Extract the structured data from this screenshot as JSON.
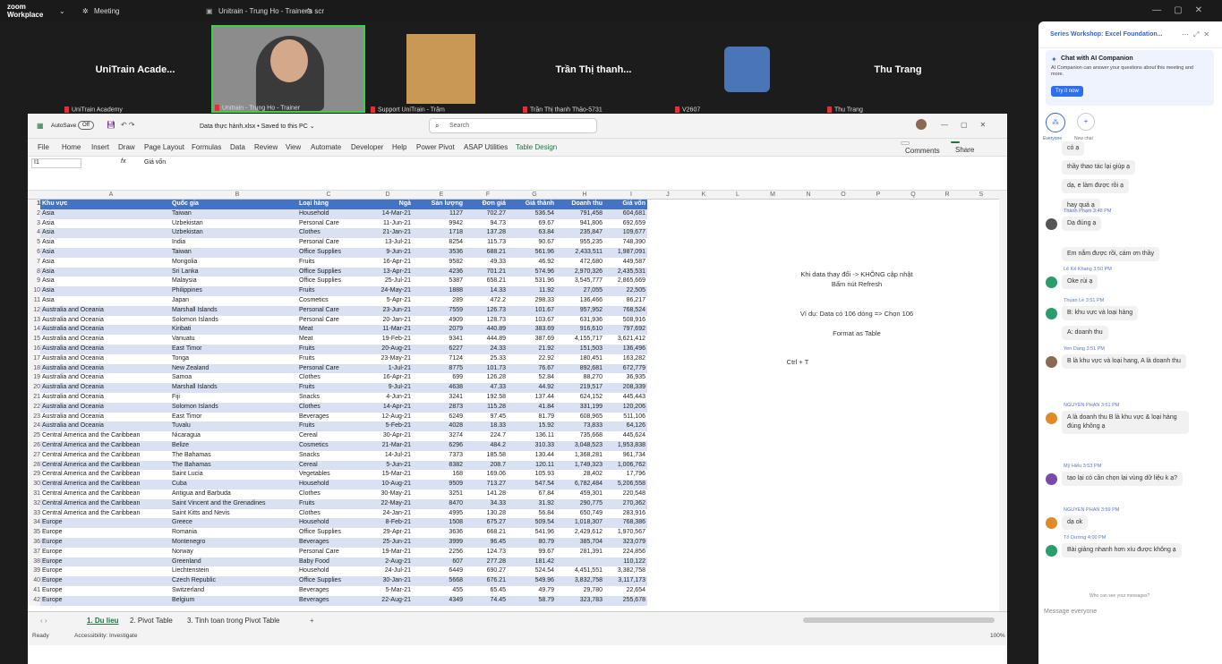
{
  "zoom": {
    "logo": "zoom",
    "logo_sub": "Workplace",
    "meeting": "Meeting",
    "share_title": "Unitrain - Trung Ho - Trainer's scr"
  },
  "videos": [
    {
      "name": "UniTrain Acade...",
      "label": "UniTrain Academy"
    },
    {
      "name": "",
      "label": "Unitrain - Trung Ho - Trainer"
    },
    {
      "name": "",
      "label": "Support UniTrain - Trâm"
    },
    {
      "name": "Trần Thị thanh...",
      "label": "Trần Thị thanh Thảo-5731"
    },
    {
      "name": "",
      "label": "V2607"
    },
    {
      "name": "Thu Trang",
      "label": "Thu Trang"
    }
  ],
  "excel": {
    "autosave": "AutoSave",
    "autosave_state": "Off",
    "file": "Data thực hành.xlsx • Saved to this PC ⌄",
    "search": "Search",
    "menu": [
      "File",
      "Home",
      "Insert",
      "Draw",
      "Page Layout",
      "Formulas",
      "Data",
      "Review",
      "View",
      "Automate",
      "Developer",
      "Help",
      "Power Pivot",
      "ASAP Utilities",
      "Table Design"
    ],
    "comments": "Comments",
    "share": "Share",
    "namebox": "I1",
    "formula": "Giá vốn",
    "fx": "fx",
    "cols": [
      "A",
      "B",
      "C",
      "D",
      "E",
      "F",
      "G",
      "H",
      "I",
      "J",
      "K",
      "L",
      "M",
      "N",
      "O",
      "P",
      "Q",
      "R",
      "S"
    ],
    "headers": [
      "Khu vực",
      "Quốc gia",
      "Loại hàng",
      "Ngà",
      "Sản lượng",
      "Đơn giá",
      "Giá thành",
      "Doanh thu",
      "Giá vốn"
    ],
    "rows": [
      [
        "Asia",
        "Taiwan",
        "Household",
        "14-Mar-21",
        "1127",
        "702.27",
        "536.54",
        "791,458",
        "604,681"
      ],
      [
        "Asia",
        "Uzbekistan",
        "Personal Care",
        "11-Jun-21",
        "9942",
        "94.73",
        "69.67",
        "941,806",
        "692,659"
      ],
      [
        "Asia",
        "Uzbekistan",
        "Clothes",
        "21-Jan-21",
        "1718",
        "137.28",
        "63.84",
        "235,847",
        "109,677"
      ],
      [
        "Asia",
        "India",
        "Personal Care",
        "13-Jul-21",
        "8254",
        "115.73",
        "90.67",
        "955,235",
        "748,390"
      ],
      [
        "Asia",
        "Taiwan",
        "Office Supplies",
        "9-Jun-21",
        "3536",
        "688.21",
        "561.96",
        "2,433,511",
        "1,987,091"
      ],
      [
        "Asia",
        "Mongolia",
        "Fruits",
        "16-Apr-21",
        "9582",
        "49.33",
        "46.92",
        "472,680",
        "449,587"
      ],
      [
        "Asia",
        "Sri Lanka",
        "Office Supplies",
        "13-Apr-21",
        "4236",
        "701.21",
        "574.96",
        "2,970,326",
        "2,435,531"
      ],
      [
        "Asia",
        "Malaysia",
        "Office Supplies",
        "25-Jul-21",
        "5387",
        "658.21",
        "531.96",
        "3,545,777",
        "2,865,669"
      ],
      [
        "Asia",
        "Philippines",
        "Fruits",
        "24-May-21",
        "1888",
        "14.33",
        "11.92",
        "27,055",
        "22,505"
      ],
      [
        "Asia",
        "Japan",
        "Cosmetics",
        "5-Apr-21",
        "289",
        "472.2",
        "298.33",
        "136,466",
        "86,217"
      ],
      [
        "Australia and Oceania",
        "Marshall Islands",
        "Personal Care",
        "23-Jun-21",
        "7559",
        "126.73",
        "101.67",
        "957,952",
        "768,524"
      ],
      [
        "Australia and Oceania",
        "Solomon Islands",
        "Personal Care",
        "20-Jan-21",
        "4909",
        "128.73",
        "103.67",
        "631,936",
        "508,916"
      ],
      [
        "Australia and Oceania",
        "Kiribati",
        "Meat",
        "11-Mar-21",
        "2079",
        "440.89",
        "383.69",
        "916,610",
        "797,692"
      ],
      [
        "Australia and Oceania",
        "Vanuatu",
        "Meat",
        "19-Feb-21",
        "9341",
        "444.89",
        "387.69",
        "4,155,717",
        "3,621,412"
      ],
      [
        "Australia and Oceania",
        "East Timor",
        "Fruits",
        "20-Aug-21",
        "6227",
        "24.33",
        "21.92",
        "151,503",
        "136,496"
      ],
      [
        "Australia and Oceania",
        "Tonga",
        "Fruits",
        "23-May-21",
        "7124",
        "25.33",
        "22.92",
        "180,451",
        "163,282"
      ],
      [
        "Australia and Oceania",
        "New Zealand",
        "Personal Care",
        "1-Jul-21",
        "8775",
        "101.73",
        "76.67",
        "892,681",
        "672,779"
      ],
      [
        "Australia and Oceania",
        "Samoa",
        "Clothes",
        "16-Apr-21",
        "699",
        "126.28",
        "52.84",
        "88,270",
        "36,935"
      ],
      [
        "Australia and Oceania",
        "Marshall Islands",
        "Fruits",
        "9-Jul-21",
        "4638",
        "47.33",
        "44.92",
        "219,517",
        "208,339"
      ],
      [
        "Australia and Oceania",
        "Fiji",
        "Snacks",
        "4-Jun-21",
        "3241",
        "192.58",
        "137.44",
        "624,152",
        "445,443"
      ],
      [
        "Australia and Oceania",
        "Solomon Islands",
        "Clothes",
        "14-Apr-21",
        "2873",
        "115.28",
        "41.84",
        "331,199",
        "120,206"
      ],
      [
        "Australia and Oceania",
        "East Timor",
        "Beverages",
        "12-Aug-21",
        "6249",
        "97.45",
        "81.79",
        "608,965",
        "511,106"
      ],
      [
        "Australia and Oceania",
        "Tuvalu",
        "Fruits",
        "5-Feb-21",
        "4028",
        "18.33",
        "15.92",
        "73,833",
        "64,126"
      ],
      [
        "Central America and the Caribbean",
        "Nicaragua",
        "Cereal",
        "30-Apr-21",
        "3274",
        "224.7",
        "136.11",
        "735,668",
        "445,624"
      ],
      [
        "Central America and the Caribbean",
        "Belize",
        "Cosmetics",
        "21-Mar-21",
        "6296",
        "484.2",
        "310.33",
        "3,048,523",
        "1,953,838"
      ],
      [
        "Central America and the Caribbean",
        "The Bahamas",
        "Snacks",
        "14-Jul-21",
        "7373",
        "185.58",
        "130.44",
        "1,368,281",
        "961,734"
      ],
      [
        "Central America and the Caribbean",
        "The Bahamas",
        "Cereal",
        "5-Jun-21",
        "8382",
        "208.7",
        "120.11",
        "1,749,323",
        "1,006,762"
      ],
      [
        "Central America and the Caribbean",
        "Saint Lucia",
        "Vegetables",
        "15-Mar-21",
        "168",
        "169.06",
        "105.93",
        "28,402",
        "17,796"
      ],
      [
        "Central America and the Caribbean",
        "Cuba",
        "Household",
        "10-Aug-21",
        "9509",
        "713.27",
        "547.54",
        "6,782,484",
        "5,206,558"
      ],
      [
        "Central America and the Caribbean",
        "Antigua and Barbuda",
        "Clothes",
        "30-May-21",
        "3251",
        "141.28",
        "67.84",
        "459,301",
        "220,548"
      ],
      [
        "Central America and the Caribbean",
        "Saint Vincent and the Grenadines",
        "Fruits",
        "22-May-21",
        "8470",
        "34.33",
        "31.92",
        "290,775",
        "270,362"
      ],
      [
        "Central America and the Caribbean",
        "Saint Kitts and Nevis",
        "Clothes",
        "24-Jan-21",
        "4995",
        "130.28",
        "56.84",
        "650,749",
        "283,916"
      ],
      [
        "Europe",
        "Greece",
        "Household",
        "8-Feb-21",
        "1508",
        "675.27",
        "509.54",
        "1,018,307",
        "768,386"
      ],
      [
        "Europe",
        "Romania",
        "Office Supplies",
        "29-Apr-21",
        "3636",
        "668.21",
        "541.96",
        "2,429,612",
        "1,970,567"
      ],
      [
        "Europe",
        "Montenegro",
        "Beverages",
        "25-Jun-21",
        "3999",
        "96.45",
        "80.79",
        "385,704",
        "323,079"
      ],
      [
        "Europe",
        "Norway",
        "Personal Care",
        "19-Mar-21",
        "2256",
        "124.73",
        "99.67",
        "281,391",
        "224,856"
      ],
      [
        "Europe",
        "Greenland",
        "Baby Food",
        "2-Aug-21",
        "607",
        "277.28",
        "181.42",
        "",
        "110,122"
      ],
      [
        "Europe",
        "Liechtenstein",
        "Household",
        "24-Jul-21",
        "6449",
        "690.27",
        "524.54",
        "4,451,551",
        "3,382,758"
      ],
      [
        "Europe",
        "Czech Republic",
        "Office Supplies",
        "30-Jan-21",
        "5668",
        "676.21",
        "549.96",
        "3,832,758",
        "3,117,173"
      ],
      [
        "Europe",
        "Switzerland",
        "Beverages",
        "5-Mar-21",
        "455",
        "65.45",
        "49.79",
        "29,780",
        "22,654"
      ],
      [
        "Europe",
        "Belgium",
        "Beverages",
        "22-Aug-21",
        "4349",
        "74.45",
        "58.79",
        "323,783",
        "255,678"
      ]
    ],
    "notes": [
      "Khi data thay đổi -> KHÔNG cập nhật",
      "Bấm nút Refresh",
      "Ví dụ: Data có 106 dòng => Chọn 106",
      "Format as Table",
      "Ctrl + T"
    ],
    "tabs": [
      "1. Du lieu",
      "2. Pivot Table",
      "3. Tinh toan trong Pivot Table"
    ],
    "status": {
      "ready": "Ready",
      "access": "Accessibility: Investigate",
      "zoom": "100%"
    }
  },
  "panel": {
    "title": "Series Workshop: Excel Foundation...",
    "ai_title": "Chat with AI Companion",
    "ai_text": "AI Companion can answer your questions about this meeting and more.",
    "try": "Try it now",
    "everyone": "Everyone",
    "newchat": "New chat",
    "messages": [
      {
        "sender": "",
        "time": "",
        "text": "có ạ"
      },
      {
        "sender": "",
        "time": "",
        "text": "thầy thao tác lại giúp ạ"
      },
      {
        "sender": "",
        "time": "",
        "text": "dạ, e làm được rồi ạ"
      },
      {
        "sender": "",
        "time": "",
        "text": "hay quá ạ"
      },
      {
        "sender": "Thành Phạm",
        "time": "3:48 PM",
        "text": "Dạ đúng ạ"
      },
      {
        "sender": "",
        "time": "",
        "text": "Em nắm được rồi, cám ơn thầy"
      },
      {
        "sender": "Lê Kế Khang",
        "time": "3:50 PM",
        "text": "Oke rùi ạ"
      },
      {
        "sender": "Thuan Le",
        "time": "3:51 PM",
        "text": "B: khu vực và loại hàng"
      },
      {
        "sender": "",
        "time": "",
        "text": "A: doanh thu"
      },
      {
        "sender": "Yen Dang",
        "time": "3:51 PM",
        "text": "B là khu vực và loại hang, A là doanh thu"
      },
      {
        "sender": "NGUYEN PHAN",
        "time": "3:51 PM",
        "text": "A là doanh thu B là khu vực & loại hàng đúng không ạ"
      },
      {
        "sender": "Mỹ Hiếu",
        "time": "3:53 PM",
        "text": "tạo lại có cần chọn lại vùng dữ liệu k ạ?"
      },
      {
        "sender": "NGUYEN PHAN",
        "time": "3:59 PM",
        "text": "dạ ok"
      },
      {
        "sender": "Tố Dương",
        "time": "4:00 PM",
        "text": "Bài giảng nhanh hơn xíu được không ạ"
      }
    ],
    "who": "Who can see your messages?",
    "placeholder": "Message everyone"
  }
}
